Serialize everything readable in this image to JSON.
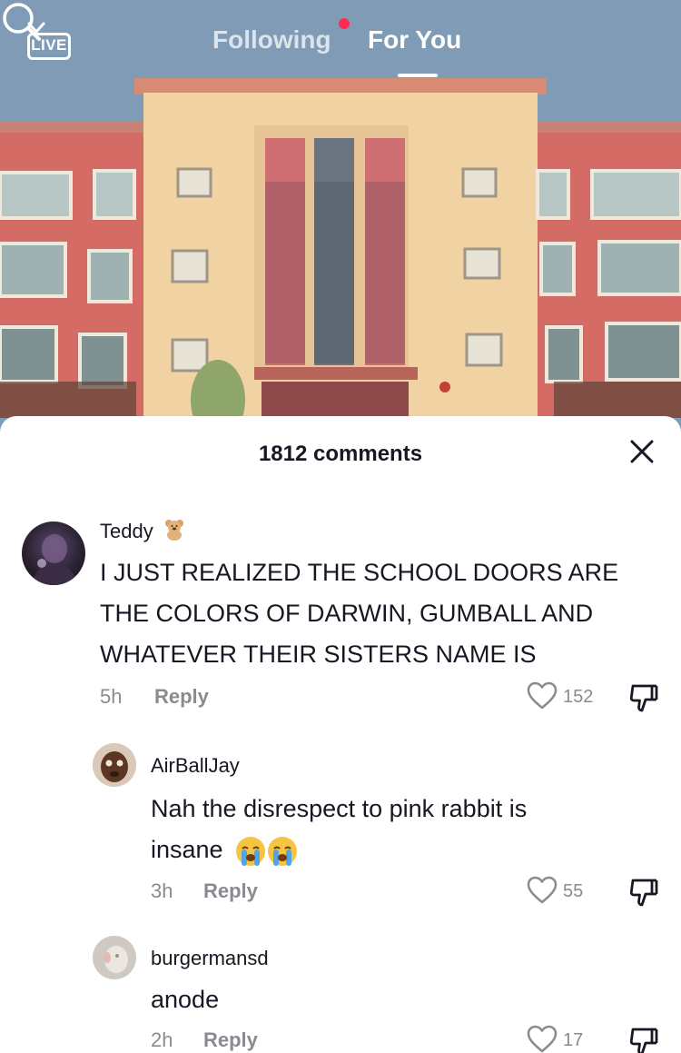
{
  "nav": {
    "live_label": "LIVE",
    "tabs": [
      {
        "label": "Following"
      },
      {
        "label": "For You"
      }
    ]
  },
  "comments_sheet": {
    "title": "1812 comments",
    "comments": [
      {
        "username": "Teddy",
        "username_emoji": "teddy-bear",
        "text": "I JUST REALIZED THE SCHOOL DOORS ARE THE COLORS OF DARWIN, GUMBALL AND WHATEVER THEIR SISTERS NAME IS",
        "time": "5h",
        "reply_label": "Reply",
        "likes": "152"
      },
      {
        "username": "AirBallJay",
        "text": "Nah the disrespect to pink rabbit is insane",
        "text_emoji": "loudly-crying-face x2",
        "time": "3h",
        "reply_label": "Reply",
        "likes": "55"
      },
      {
        "username": "burgermansd",
        "text": "anode",
        "time": "2h",
        "reply_label": "Reply",
        "likes": "17"
      }
    ]
  },
  "colors": {
    "accent": "#fe2c55",
    "text": "#161823",
    "muted": "#8a8b91",
    "building_facade": "#f2d6a4",
    "building_wings": "#d86a64"
  }
}
